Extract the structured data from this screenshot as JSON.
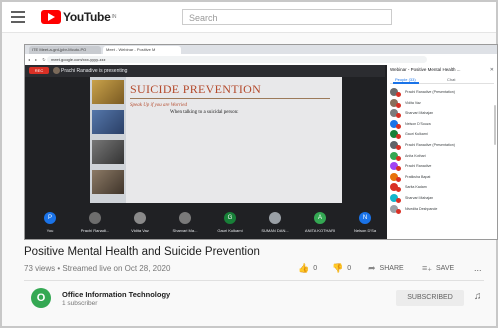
{
  "youtube": {
    "logo_text": "YouTube",
    "logo_sup": "IN",
    "search_placeholder": "Search"
  },
  "browser": {
    "tabs": [
      "ITE Meet-a-grd-jpbr-Mcuto-PO",
      "Meet - Webinar - Positive M"
    ],
    "url": "meet.google.com/xxx-yyyy-zzz"
  },
  "meet": {
    "rec_label": "REC",
    "presenter_text": "Prachi Ranadive is presenting",
    "slide": {
      "title": "SUICIDE PREVENTION",
      "subtitle": "Speak Up if you are Worried",
      "subtitle2": "When talking to a suicidal person:"
    },
    "tiles": [
      {
        "initial": "P",
        "name": "You",
        "color": "#1a73e8"
      },
      {
        "initial": "",
        "name": "Prachi Ranadi...",
        "color": "#6d6d6d"
      },
      {
        "initial": "",
        "name": "Vidita Vaz",
        "color": "#8a8a8a"
      },
      {
        "initial": "",
        "name": "Sharvari Ma...",
        "color": "#7a7a7a"
      },
      {
        "initial": "G",
        "name": "Gauri Kulkarni",
        "color": "#188038"
      },
      {
        "initial": "",
        "name": "SUMAN DAN...",
        "color": "#9aa0a6"
      },
      {
        "initial": "A",
        "name": "ANITA KOTHARI",
        "color": "#34a853"
      },
      {
        "initial": "N",
        "name": "Nelson D'Sa",
        "color": "#1a73e8"
      }
    ],
    "panel": {
      "header": "Webinar - Positive Mental Health ...",
      "tab_people": "People (33)",
      "tab_chat": "Chat",
      "participants": [
        {
          "name": "Prachi Ranadive (Presentation)",
          "color": "#6b6b6b"
        },
        {
          "name": "Vidita Vaz",
          "color": "#8a6f5a"
        },
        {
          "name": "Sharvari Mahajan",
          "color": "#7c7c7c"
        },
        {
          "name": "Nelson D'Souza",
          "color": "#1a73e8"
        },
        {
          "name": "Gauri Kulkarni",
          "color": "#188038"
        },
        {
          "name": "Prachi Ranadive (Presentation)",
          "color": "#5f6368"
        },
        {
          "name": "Anita Kothari",
          "color": "#34a853"
        },
        {
          "name": "Prachi Ranadive",
          "color": "#a142f4"
        },
        {
          "name": "Pratiksha Bapat",
          "color": "#e8710a"
        },
        {
          "name": "Sarita Kadam",
          "color": "#d93025"
        },
        {
          "name": "Sharvari Mahajan",
          "color": "#12b5cb"
        },
        {
          "name": "Nivedita Deshpande",
          "color": "#9aa0a6"
        }
      ]
    }
  },
  "video": {
    "title": "Positive Mental Health and Suicide Prevention",
    "meta": "73 views • Streamed live on Oct 28, 2020",
    "likes": "0",
    "dislikes": "0",
    "share_label": "SHARE",
    "save_label": "SAVE",
    "more_label": "..."
  },
  "channel": {
    "avatar_initial": "O",
    "name": "Office Information Technology",
    "subscribers": "1 subscriber",
    "subscribed_label": "SUBSCRIBED"
  }
}
